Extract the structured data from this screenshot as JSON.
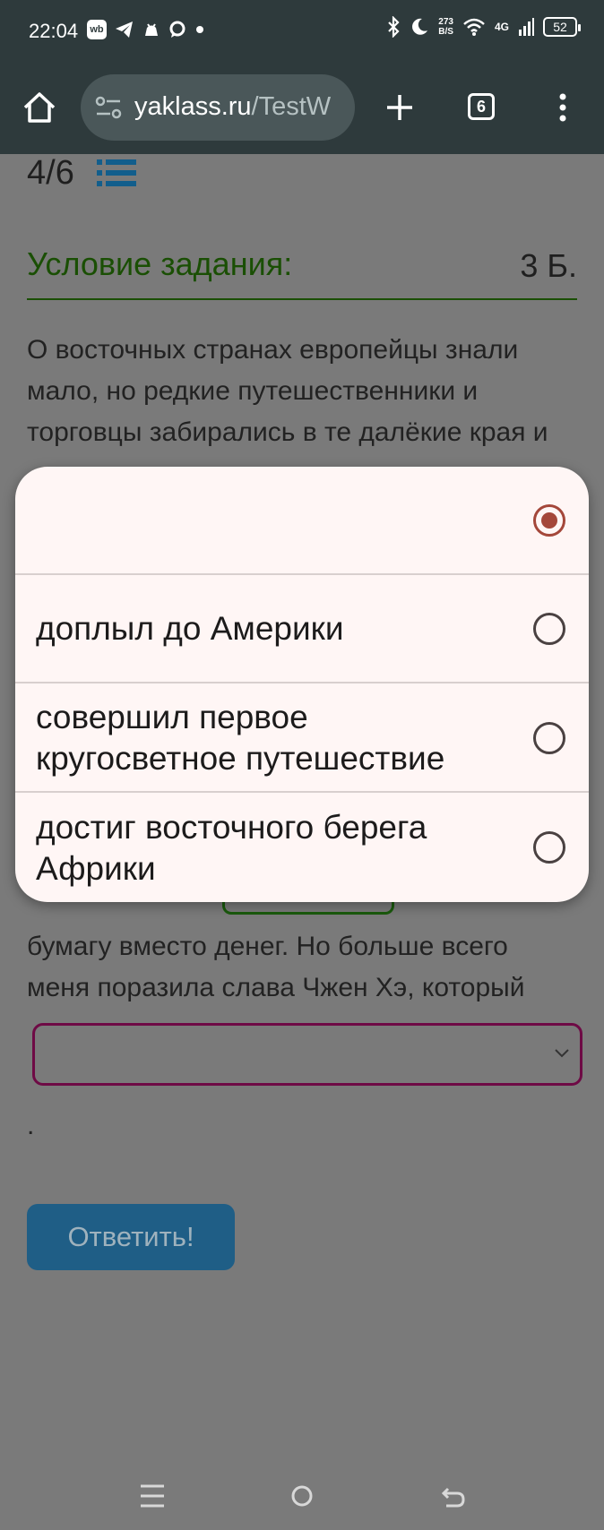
{
  "status_bar": {
    "time": "22:04",
    "left_icons": [
      "wb-icon",
      "telegram-icon",
      "android-icon",
      "chat-bubble-icon",
      "dot-icon"
    ],
    "net_speed_value": "273",
    "net_speed_unit": "B/S",
    "network": "4G",
    "battery": "52",
    "right_icons": [
      "bluetooth-icon",
      "moon-icon",
      "wifi-icon",
      "signal-icon",
      "battery-icon"
    ]
  },
  "browser": {
    "url_main": "yaklass.ru",
    "url_path": "/TestW",
    "tab_count": "6",
    "icons": [
      "home-icon",
      "tune-icon",
      "plus-icon",
      "tabs-icon",
      "more-vert-icon"
    ]
  },
  "task": {
    "progress": "4/6",
    "condition_title": "Условие задания:",
    "points": "3 Б.",
    "paragraph_top": "О восточных странах европейцы знали мало, но редкие путешественники и торговцы забирались в те далёкие края и",
    "paragraph_bottom": "бумагу вместо денег. Но больше всего меня поразила слава Чжен Хэ, который",
    "trailing_period": "."
  },
  "select": {
    "selected_value": ""
  },
  "answer_button": {
    "label": "Ответить!"
  },
  "dropdown": {
    "options": [
      {
        "label": "",
        "selected": true
      },
      {
        "label": "доплыл до Америки",
        "selected": false
      },
      {
        "label": "совершил первое кругосветное путешествие",
        "selected": false
      },
      {
        "label": "достиг восточного берега Африки",
        "selected": false
      }
    ]
  },
  "nav_bar": {
    "icons": [
      "recents-menu-icon",
      "home-circle-icon",
      "back-icon"
    ]
  },
  "colors": {
    "browser_bar": "#2e3a3c",
    "condition_green": "#1a4f04",
    "select_border": "#6e0a45",
    "button_bg": "#1f5e86",
    "radio_selected": "#a4473a",
    "dropdown_bg": "#fff6f5"
  }
}
